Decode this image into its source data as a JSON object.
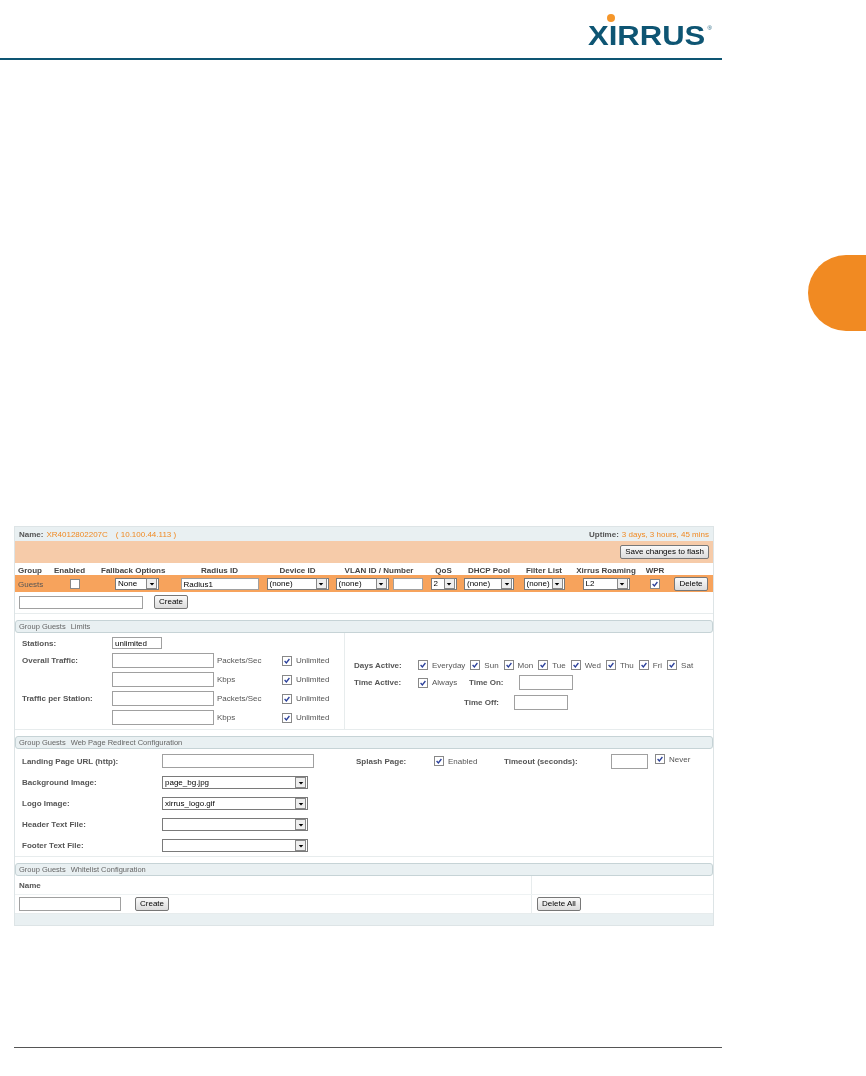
{
  "logo": {
    "text": "XIRRUS",
    "mark": "®"
  },
  "panel": {
    "name_label": "Name:",
    "name_value": "XR4012802207C",
    "ip": "( 10.100.44.113 )",
    "uptime_label": "Uptime:",
    "uptime_value": "3 days, 3 hours, 45 mins",
    "save_button": "Save changes to flash"
  },
  "groups_table": {
    "columns": [
      "Group",
      "Enabled",
      "Fallback Options",
      "Radius ID",
      "Device ID",
      "VLAN ID / Number",
      "QoS",
      "DHCP Pool",
      "Filter List",
      "Xirrus Roaming",
      "WPR"
    ],
    "rows": [
      {
        "cells": [
          {
            "kind": "text",
            "value": "Guests"
          },
          {
            "kind": "checkbox",
            "checked": false
          },
          {
            "kind": "select",
            "value": "None"
          },
          {
            "kind": "input",
            "value": "Radius1"
          },
          {
            "kind": "select",
            "value": "(none)"
          },
          {
            "kind": "select_number",
            "value": "(none)"
          },
          {
            "kind": "select",
            "value": "2"
          },
          {
            "kind": "select",
            "value": "(none)"
          },
          {
            "kind": "select",
            "value": "(none)"
          },
          {
            "kind": "select",
            "value": "L2"
          },
          {
            "kind": "checkbox",
            "checked": true
          },
          {
            "kind": "button",
            "value": "Delete"
          }
        ]
      }
    ],
    "create_button": "Create"
  },
  "limits": {
    "title": [
      "Group Guests",
      "Limits"
    ],
    "stations_label": "Stations:",
    "stations_value": "unlimited",
    "traffic": [
      {
        "label": "Overall Traffic:",
        "unit": "Packets/Sec",
        "option": "Unlimited",
        "checked": true
      },
      {
        "unit": "Kbps",
        "option": "Unlimited",
        "checked": true
      },
      {
        "label": "Traffic per Station:",
        "unit": "Packets/Sec",
        "option": "Unlimited",
        "checked": true
      },
      {
        "unit": "Kbps",
        "option": "Unlimited",
        "checked": true
      }
    ],
    "days_label": "Days Active:",
    "days": [
      {
        "label": "Everyday",
        "checked": true
      },
      {
        "label": "Sun",
        "checked": true
      },
      {
        "label": "Mon",
        "checked": true
      },
      {
        "label": "Tue",
        "checked": true
      },
      {
        "label": "Wed",
        "checked": true
      },
      {
        "label": "Thu",
        "checked": true
      },
      {
        "label": "Fri",
        "checked": true
      },
      {
        "label": "Sat",
        "checked": true
      }
    ],
    "time_label": "Time Active:",
    "always": {
      "label": "Always",
      "checked": true
    },
    "time_on_label": "Time On:",
    "time_off_label": "Time Off:"
  },
  "redirect": {
    "title": [
      "Group Guests",
      "Web Page Redirect Configuration"
    ],
    "fields": [
      {
        "label": "Landing Page URL (http):",
        "kind": "input"
      },
      {
        "label": "Background Image:",
        "kind": "select",
        "value": "page_bg.jpg"
      },
      {
        "label": "Logo Image:",
        "kind": "select",
        "value": "xirrus_logo.gif"
      },
      {
        "label": "Header Text File:",
        "kind": "select"
      },
      {
        "label": "Footer Text File:",
        "kind": "select"
      }
    ],
    "splash_label": "Splash Page:",
    "splash": {
      "label": "Enabled",
      "checked": true
    },
    "timeout_label": "Timeout (seconds):",
    "never": {
      "label": "Never",
      "checked": true
    }
  },
  "whitelist": {
    "title": [
      "Group Guests",
      "Whitelist Configuration"
    ],
    "column": "Name",
    "create_button": "Create",
    "delete_all_button": "Delete All"
  }
}
